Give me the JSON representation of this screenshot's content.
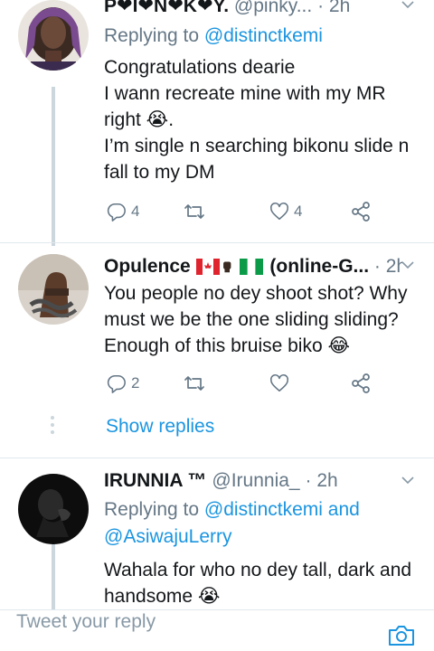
{
  "tweets": [
    {
      "name": "P❤I❤N❤K❤Y.",
      "handle": "@pinky...",
      "dot": "·",
      "time": "2h",
      "replying_label": "Replying to",
      "mentions": [
        "@distinctkemi"
      ],
      "body": "Congratulations dearie\nI wann recreate mine with my MR\nright 😭.\nI’m single n searching bikonu slide n\nfall to my DM",
      "reply_count": "4",
      "retweet_count": "",
      "like_count": "4"
    },
    {
      "name": "Opulence",
      "name_suffix": "(online-G...",
      "flags": [
        "canada-flag",
        "fist-icon",
        "nigeria-flag"
      ],
      "handle": "",
      "dot": "·",
      "time": "2h",
      "body": "You people no dey shoot shot?  Why\nmust we be the one sliding sliding?\nEnough of this bruise biko 😂",
      "reply_count": "2",
      "retweet_count": "",
      "like_count": ""
    },
    {
      "name": "IRUNNIA ™",
      "handle": "@Irunnia_",
      "dot": "·",
      "time": "2h",
      "replying_label": "Replying to",
      "mentions": [
        "@distinctkemi",
        "and",
        "@AsiwajuLerry"
      ],
      "body": "Wahala for who no dey tall, dark and\nhandsome 😭"
    }
  ],
  "show_replies": "Show replies",
  "compose": {
    "placeholder": "Tweet your reply"
  },
  "icons": {
    "reply": "reply-icon",
    "retweet": "retweet-icon",
    "like": "heart-icon",
    "share": "share-icon",
    "more": "chevron-down-icon",
    "camera": "camera-icon"
  },
  "colors": {
    "link": "#1b95e0",
    "muted": "#657786",
    "text": "#14171a",
    "line": "#ccd6dd"
  }
}
